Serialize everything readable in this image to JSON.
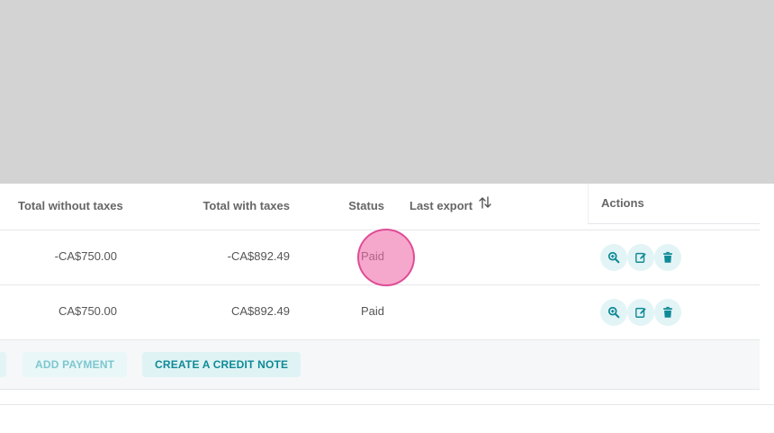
{
  "table": {
    "headers": {
      "total_without_taxes": "Total without taxes",
      "total_with_taxes": "Total with taxes",
      "status": "Status",
      "last_export": "Last export",
      "actions": "Actions"
    },
    "rows": [
      {
        "total_without_taxes": "-CA$750.00",
        "total_with_taxes": "-CA$892.49",
        "status": "Paid",
        "last_export": ""
      },
      {
        "total_without_taxes": "CA$750.00",
        "total_with_taxes": "CA$892.49",
        "status": "Paid",
        "last_export": ""
      }
    ]
  },
  "footer": {
    "add_payment_label": "ADD PAYMENT",
    "create_credit_note_label": "CREATE A CREDIT NOTE"
  },
  "icons": {
    "sort": "sort-arrows-icon",
    "view": "zoom-in-icon",
    "edit": "edit-icon",
    "delete": "trash-icon"
  },
  "colors": {
    "overlay": "#d3d3d3",
    "accent": "#0f8a96",
    "action_bg": "#e3f4f6",
    "cursor_highlight": "#f06eaa"
  }
}
